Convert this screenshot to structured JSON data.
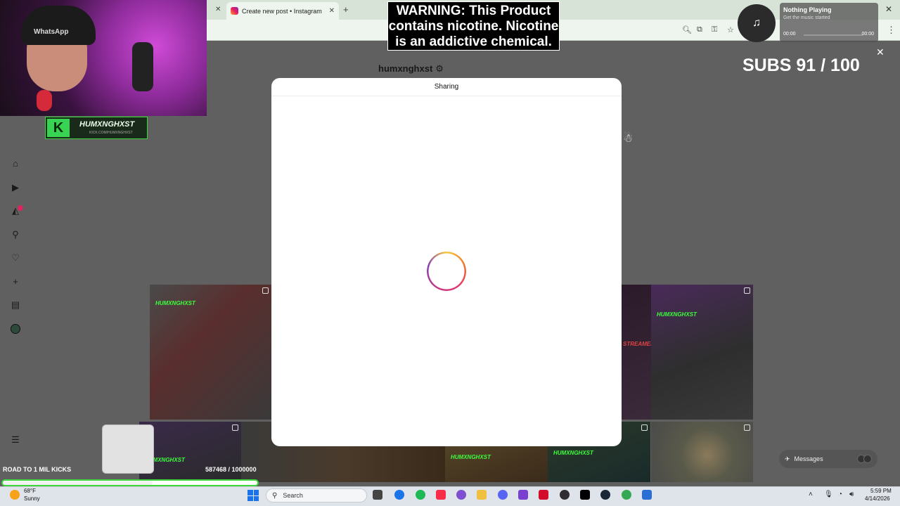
{
  "browser": {
    "tab_title": "Create new post • Instagram",
    "tab_close": "✕",
    "new_tab": "+",
    "window_close": "✕",
    "menu": "⋮",
    "toolbar_icons": [
      "zoom-icon",
      "install-icon",
      "password-key-icon",
      "bookmark-star-icon"
    ]
  },
  "instagram": {
    "profile_username": "humxnghxst",
    "modal": {
      "title": "Sharing",
      "close": "✕"
    },
    "nav_icons": [
      "home-icon",
      "reels-icon",
      "explore-icon",
      "search-icon",
      "notifications-heart-icon",
      "create-plus-icon",
      "dashboard-icon",
      "profile-avatar",
      "more-menu-icon"
    ],
    "thumb_labels": [
      "HUMXNGHXST",
      "STREAMED",
      "HUMXNGHXST",
      "HUMXNGHXST",
      "HUMXNGHXST",
      "HUMXNGHXST"
    ],
    "messages_label": "Messages"
  },
  "overlays": {
    "webcam_hat_text": "WhatsApp",
    "kick_name": "HUMXNGHXST",
    "kick_url": "KICK.COM/HUMXNGHXST",
    "warning_text": "WARNING: This Product contains nicotine. Nicotine is an addictive chemical.",
    "music": {
      "title": "Nothing Playing",
      "subtitle": "Get the music started",
      "time_elapsed": "00:00",
      "time_total": "00:00"
    },
    "subs_text": "SUBS 91 / 100",
    "road_label": "ROAD TO 1 MIL KICKS",
    "road_count": "587468 / 1000000",
    "road_progress": 0.587468
  },
  "taskbar": {
    "weather_temp": "68°F",
    "weather_condition": "Sunny",
    "search_placeholder": "Search",
    "time": "5:59 PM",
    "date": "4/14/2026",
    "app_icons": [
      "file-explorer-icon",
      "chrome-icon",
      "spotify-icon",
      "apple-music-icon",
      "tor-icon",
      "folder-icon",
      "discord-icon",
      "app-icon",
      "opera-icon",
      "obs-icon",
      "kick-icon",
      "steam-icon",
      "chrome-profile-icon",
      "app-icon-2"
    ],
    "colors": {
      "chrome": "#1a73e8",
      "spotify": "#1db954",
      "music": "#fa2d48",
      "discord": "#5865f2",
      "opera": "#d40c2b",
      "obs": "#302e31",
      "kick": "#000000",
      "steam": "#1b2838"
    }
  }
}
